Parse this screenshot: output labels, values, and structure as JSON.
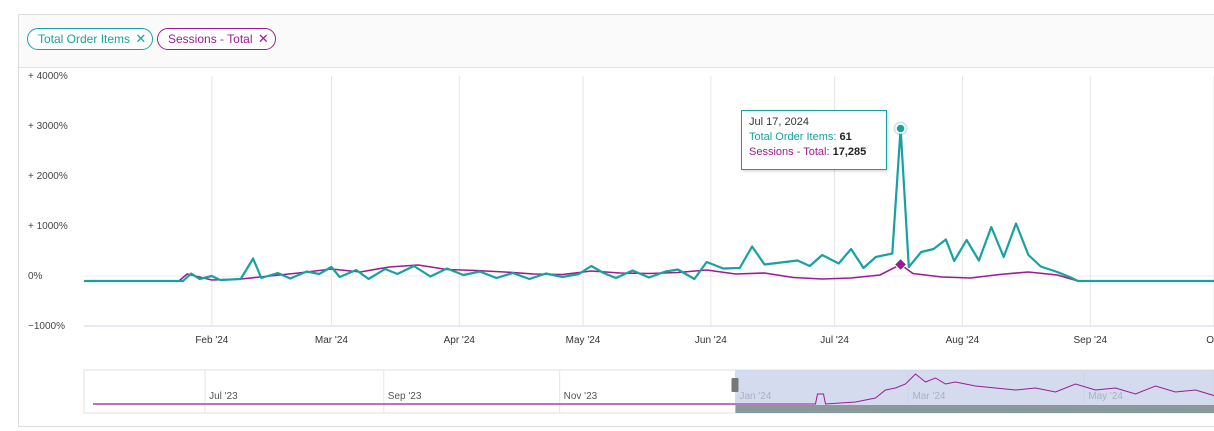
{
  "filters": {
    "chips": [
      {
        "label": "Total Order Items",
        "color": "#17a2a0"
      },
      {
        "label": "Sessions - Total",
        "color": "#9b1c91"
      }
    ],
    "remove_glyph": "✕"
  },
  "tooltip": {
    "date": "Jul 17, 2024",
    "series1_label": "Total Order Items",
    "series1_value": "61",
    "series2_label": "Sessions - Total",
    "series2_value": "17,285"
  },
  "navigator": {
    "ticks": [
      "Jul '23",
      "Sep '23",
      "Nov '23",
      "Jan '24",
      "Mar '24",
      "May '24"
    ]
  },
  "chart_data": {
    "type": "line",
    "y_tick_labels": [
      "+ 4000%",
      "+ 3000%",
      "+ 2000%",
      "+ 1000%",
      "0%",
      "−1000%"
    ],
    "y_ticks": [
      4000,
      3000,
      2000,
      1000,
      0,
      -1000
    ],
    "ylim": [
      -1000,
      4000
    ],
    "x_tick_labels": [
      "Feb '24",
      "Mar '24",
      "Apr '24",
      "May '24",
      "Jun '24",
      "Jul '24",
      "Aug '24",
      "Sep '24",
      "Oct"
    ],
    "x_ticks": [
      "2024-02-01",
      "2024-03-01",
      "2024-04-01",
      "2024-05-01",
      "2024-06-01",
      "2024-07-01",
      "2024-08-01",
      "2024-09-01",
      "2024-10-01"
    ],
    "xlim": [
      "2024-01-01",
      "2024-10-01"
    ],
    "grid": "vertical",
    "series": [
      {
        "name": "Total Order Items",
        "color": "#17a2a0",
        "points": [
          [
            "2024-01-01",
            -100
          ],
          [
            "2024-01-25",
            -100
          ],
          [
            "2024-01-27",
            50
          ],
          [
            "2024-01-29",
            -60
          ],
          [
            "2024-02-01",
            0
          ],
          [
            "2024-02-03",
            -80
          ],
          [
            "2024-02-08",
            -60
          ],
          [
            "2024-02-11",
            350
          ],
          [
            "2024-02-13",
            -40
          ],
          [
            "2024-02-17",
            60
          ],
          [
            "2024-02-20",
            -50
          ],
          [
            "2024-02-24",
            90
          ],
          [
            "2024-02-27",
            40
          ],
          [
            "2024-03-01",
            180
          ],
          [
            "2024-03-03",
            -20
          ],
          [
            "2024-03-07",
            120
          ],
          [
            "2024-03-10",
            -60
          ],
          [
            "2024-03-14",
            140
          ],
          [
            "2024-03-17",
            40
          ],
          [
            "2024-03-21",
            200
          ],
          [
            "2024-03-25",
            -10
          ],
          [
            "2024-03-29",
            150
          ],
          [
            "2024-04-02",
            20
          ],
          [
            "2024-04-06",
            90
          ],
          [
            "2024-04-10",
            -40
          ],
          [
            "2024-04-14",
            60
          ],
          [
            "2024-04-18",
            -60
          ],
          [
            "2024-04-22",
            50
          ],
          [
            "2024-04-26",
            -20
          ],
          [
            "2024-04-30",
            40
          ],
          [
            "2024-05-03",
            200
          ],
          [
            "2024-05-06",
            60
          ],
          [
            "2024-05-09",
            -40
          ],
          [
            "2024-05-13",
            110
          ],
          [
            "2024-05-17",
            -30
          ],
          [
            "2024-05-21",
            90
          ],
          [
            "2024-05-24",
            130
          ],
          [
            "2024-05-28",
            -60
          ],
          [
            "2024-05-31",
            280
          ],
          [
            "2024-06-04",
            150
          ],
          [
            "2024-06-08",
            160
          ],
          [
            "2024-06-11",
            590
          ],
          [
            "2024-06-14",
            230
          ],
          [
            "2024-06-18",
            270
          ],
          [
            "2024-06-22",
            310
          ],
          [
            "2024-06-25",
            200
          ],
          [
            "2024-06-28",
            420
          ],
          [
            "2024-07-02",
            250
          ],
          [
            "2024-07-05",
            540
          ],
          [
            "2024-07-08",
            160
          ],
          [
            "2024-07-11",
            380
          ],
          [
            "2024-07-15",
            450
          ],
          [
            "2024-07-17",
            2950
          ],
          [
            "2024-07-19",
            180
          ],
          [
            "2024-07-22",
            480
          ],
          [
            "2024-07-25",
            540
          ],
          [
            "2024-07-28",
            730
          ],
          [
            "2024-07-30",
            300
          ],
          [
            "2024-08-02",
            720
          ],
          [
            "2024-08-05",
            310
          ],
          [
            "2024-08-08",
            980
          ],
          [
            "2024-08-11",
            380
          ],
          [
            "2024-08-14",
            1050
          ],
          [
            "2024-08-17",
            420
          ],
          [
            "2024-08-20",
            190
          ],
          [
            "2024-08-24",
            80
          ],
          [
            "2024-08-27",
            -20
          ],
          [
            "2024-08-29",
            -100
          ],
          [
            "2024-10-01",
            -100
          ]
        ]
      },
      {
        "name": "Sessions - Total",
        "color": "#9b1c91",
        "points": [
          [
            "2024-01-01",
            -100
          ],
          [
            "2024-01-24",
            -100
          ],
          [
            "2024-01-26",
            40
          ],
          [
            "2024-02-01",
            -80
          ],
          [
            "2024-02-08",
            -60
          ],
          [
            "2024-02-15",
            0
          ],
          [
            "2024-02-22",
            60
          ],
          [
            "2024-03-01",
            140
          ],
          [
            "2024-03-08",
            80
          ],
          [
            "2024-03-15",
            180
          ],
          [
            "2024-03-22",
            220
          ],
          [
            "2024-03-29",
            130
          ],
          [
            "2024-04-05",
            110
          ],
          [
            "2024-04-12",
            80
          ],
          [
            "2024-04-19",
            40
          ],
          [
            "2024-04-26",
            30
          ],
          [
            "2024-05-03",
            100
          ],
          [
            "2024-05-10",
            60
          ],
          [
            "2024-05-17",
            50
          ],
          [
            "2024-05-24",
            70
          ],
          [
            "2024-05-31",
            120
          ],
          [
            "2024-06-07",
            40
          ],
          [
            "2024-06-14",
            60
          ],
          [
            "2024-06-21",
            -30
          ],
          [
            "2024-06-28",
            -60
          ],
          [
            "2024-07-05",
            -40
          ],
          [
            "2024-07-12",
            20
          ],
          [
            "2024-07-17",
            230
          ],
          [
            "2024-07-20",
            50
          ],
          [
            "2024-07-27",
            -20
          ],
          [
            "2024-08-03",
            -40
          ],
          [
            "2024-08-10",
            30
          ],
          [
            "2024-08-17",
            80
          ],
          [
            "2024-08-24",
            20
          ],
          [
            "2024-08-29",
            -100
          ],
          [
            "2024-10-01",
            -100
          ]
        ]
      }
    ],
    "highlight": {
      "date": "2024-07-17",
      "series1_y": 2950,
      "series2_y": 230
    }
  }
}
